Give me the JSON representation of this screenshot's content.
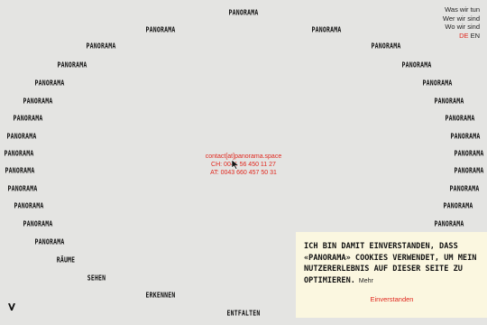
{
  "ring_words": [
    "PANORAMA",
    "PANORAMA",
    "PANORAMA",
    "PANORAMA",
    "PANORAMA",
    "PANORAMA",
    "PANORAMA",
    "PANORAMA",
    "PANORAMA",
    "PANORAMA",
    "PANORAMA",
    "PANORAMA",
    "PANORAMA",
    "PANORAMA",
    "PANORAMA",
    "PANORAMA",
    "PANORAMA",
    "PANORAMA",
    "PANORAMA",
    "PANORAMA",
    "PANORAMA",
    "PANORAMA",
    "PANORAMA",
    "PANORAMA",
    "PANORAMA",
    "PANORAMA",
    "PANORAMA",
    "RÄUME",
    "SEHEN",
    "ERKENNEN",
    "ENTFALTEN"
  ],
  "nav": {
    "items": [
      "Was wir tun",
      "Wer wir sind",
      "Wo wir sind"
    ],
    "lang_de": "DE",
    "lang_en": "EN"
  },
  "contact": {
    "email": "contact[at]panorama.space",
    "phone_ch": "CH: 0041 56 450 11 27",
    "phone_at": "AT: 0043 660 457 50 31"
  },
  "cookie": {
    "text": "ICH BIN DAMIT EINVERSTANDEN, DASS «PANORAMA» COOKIES VERWENDET, UM MEIN NUTZERERLEBNIS AUF DIESER SEITE ZU OPTIMIEREN.",
    "more": "Mehr",
    "accept": "Einverstanden"
  },
  "colors": {
    "background": "#e4e4e2",
    "accent": "#e0281f",
    "banner": "#fbf7e0"
  },
  "logo_icon": "panorama-v-logo-icon"
}
